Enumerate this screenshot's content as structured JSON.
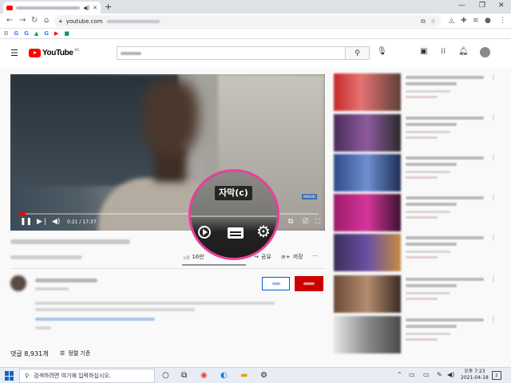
{
  "browser": {
    "url_prefix": "youtube.com",
    "bookmarks": [
      {
        "label": "G",
        "color": "#4285f4"
      },
      {
        "label": "G",
        "color": "#4285f4"
      },
      {
        "label": "▲",
        "color": "#0f9d58"
      },
      {
        "label": "G",
        "color": "#4285f4"
      },
      {
        "label": "▶",
        "color": "#ff0000"
      },
      {
        "label": "■",
        "color": "#0f9d58"
      }
    ]
  },
  "youtube": {
    "logo_text": "YouTube",
    "region": "KR"
  },
  "player": {
    "time": "0:21 / 17:37",
    "progress_fraction": 0.02,
    "tooltip": "자막(c)",
    "overlay_brand": "MKBHD"
  },
  "video": {
    "like_count": "16만",
    "share_label": "공유",
    "save_label": "저장",
    "more": "···"
  },
  "comments": {
    "count_label": "댓글 8,931개",
    "sort_label": "정렬 기준"
  },
  "taskbar": {
    "search_placeholder": "검색하려면 여기에 입력하십시오.",
    "time": "오후 7:23",
    "date": "2021-04-18",
    "notification_count": "2"
  },
  "colors": {
    "accent": "#ff0000",
    "highlight_ring": "#e8409a",
    "link": "#065fd4"
  }
}
